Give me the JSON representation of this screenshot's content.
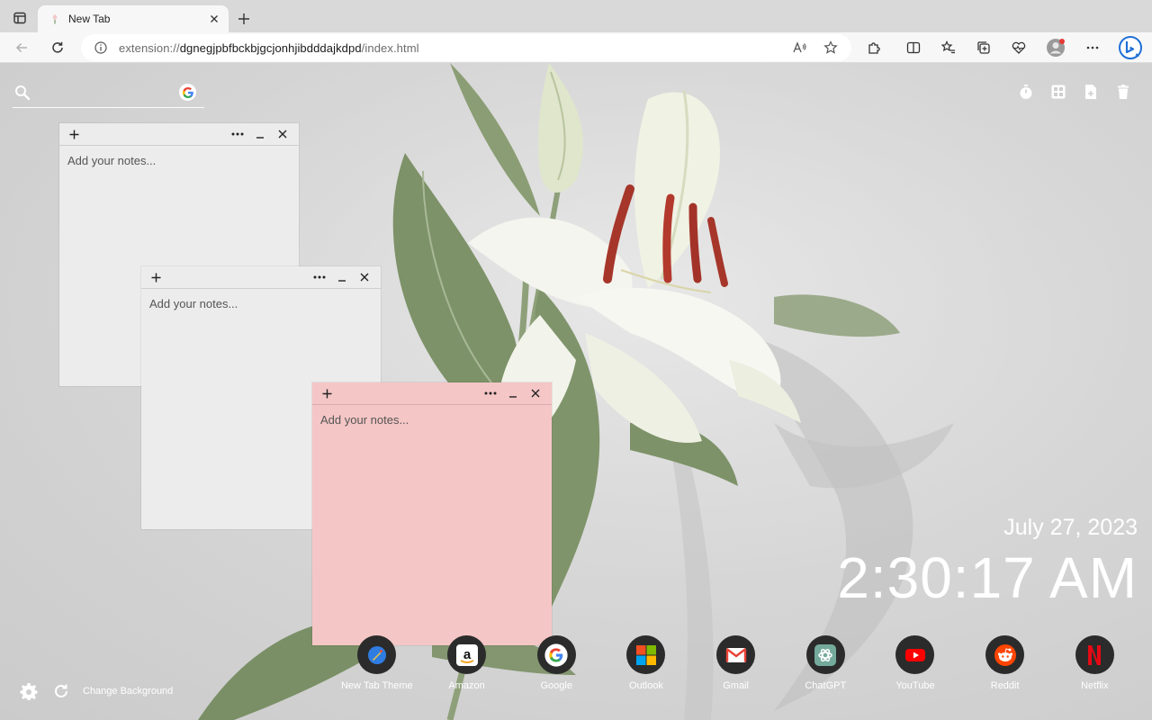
{
  "tab": {
    "title": "New Tab"
  },
  "address_bar": {
    "scheme": "extension://",
    "host": "dgnegjpbfbckbjgcjonhjibdddajkdpd",
    "path": "/index.html",
    "read_aloud_glyph": "Aᴬ"
  },
  "search": {
    "placeholder": ""
  },
  "notes": [
    {
      "placeholder": "Add your notes...",
      "color": "#ececec"
    },
    {
      "placeholder": "Add your notes...",
      "color": "#ececec"
    },
    {
      "placeholder": "Add your notes...",
      "color": "#f5c6c6"
    }
  ],
  "datetime": {
    "date": "July 27, 2023",
    "time": "2:30:17 AM"
  },
  "shortcuts": [
    {
      "label": "New Tab Theme",
      "icon": "new-tab-theme-icon"
    },
    {
      "label": "Amazon",
      "icon": "amazon-icon"
    },
    {
      "label": "Google",
      "icon": "google-icon"
    },
    {
      "label": "Outlook",
      "icon": "outlook-icon"
    },
    {
      "label": "Gmail",
      "icon": "gmail-icon"
    },
    {
      "label": "ChatGPT",
      "icon": "chatgpt-icon"
    },
    {
      "label": "YouTube",
      "icon": "youtube-icon"
    },
    {
      "label": "Reddit",
      "icon": "reddit-icon"
    },
    {
      "label": "Netflix",
      "icon": "netflix-icon"
    }
  ],
  "bottom": {
    "change_background_label": "Change Background"
  },
  "colors": {
    "note_grey": "#ececec",
    "note_pink": "#f5c6c6",
    "shortcut_bg": "#2b2b2b",
    "text_white": "#ffffff"
  }
}
